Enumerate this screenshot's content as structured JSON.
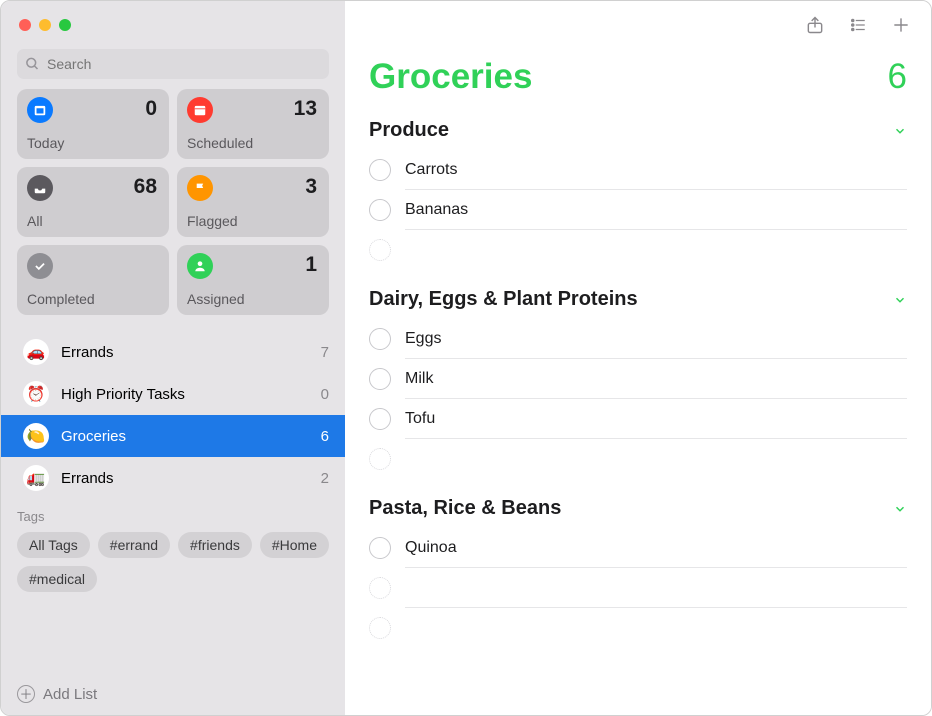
{
  "search": {
    "placeholder": "Search"
  },
  "smartLists": {
    "today": {
      "label": "Today",
      "count": "0"
    },
    "scheduled": {
      "label": "Scheduled",
      "count": "13"
    },
    "all": {
      "label": "All",
      "count": "68"
    },
    "flagged": {
      "label": "Flagged",
      "count": "3"
    },
    "completed": {
      "label": "Completed",
      "count": ""
    },
    "assigned": {
      "label": "Assigned",
      "count": "1"
    }
  },
  "lists": [
    {
      "name": "Errands",
      "count": "7",
      "emoji": "🚗"
    },
    {
      "name": "High Priority Tasks",
      "count": "0",
      "emoji": "⏰"
    },
    {
      "name": "Groceries",
      "count": "6",
      "emoji": "🍋"
    },
    {
      "name": "Errands",
      "count": "2",
      "emoji": "🚛"
    }
  ],
  "tagsLabel": "Tags",
  "tags": [
    "All Tags",
    "#errand",
    "#friends",
    "#Home",
    "#medical"
  ],
  "addList": "Add List",
  "main": {
    "title": "Groceries",
    "count": "6",
    "sections": [
      {
        "title": "Produce",
        "items": [
          "Carrots",
          "Bananas"
        ]
      },
      {
        "title": "Dairy, Eggs & Plant Proteins",
        "items": [
          "Eggs",
          "Milk",
          "Tofu"
        ]
      },
      {
        "title": "Pasta, Rice & Beans",
        "items": [
          "Quinoa"
        ]
      }
    ]
  }
}
